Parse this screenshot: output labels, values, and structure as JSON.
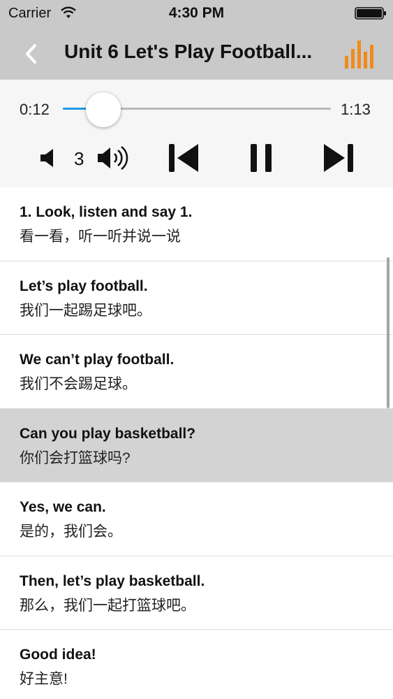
{
  "status_bar": {
    "carrier": "Carrier",
    "time": "4:30 PM",
    "wifi_icon": "wifi-icon",
    "battery_icon": "battery-icon"
  },
  "nav": {
    "title": "Unit 6 Let's Play Football...",
    "back_icon": "back-chevron-icon",
    "equalizer_icon": "equalizer-icon",
    "accent_color": "#f08b1a"
  },
  "player": {
    "elapsed": "0:12",
    "total": "1:13",
    "progress": 0.15,
    "progress_color": "#1e9be3",
    "volume_level": "3"
  },
  "lyrics": {
    "items": [
      {
        "en": "1. Look, listen and say 1.",
        "zh": "看一看，听一听并说一说",
        "active": false
      },
      {
        "en": "Let’s play football.",
        "zh": "我们一起踢足球吧。",
        "active": false
      },
      {
        "en": "We can’t play football.",
        "zh": "我们不会踢足球。",
        "active": false
      },
      {
        "en": "Can you play basketball?",
        "zh": "你们会打篮球吗?",
        "active": true
      },
      {
        "en": "Yes, we can.",
        "zh": "是的，我们会。",
        "active": false
      },
      {
        "en": "Then, let’s play basketball.",
        "zh": "那么，我们一起打篮球吧。",
        "active": false
      },
      {
        "en": "Good idea!",
        "zh": "好主意!",
        "active": false
      }
    ]
  }
}
